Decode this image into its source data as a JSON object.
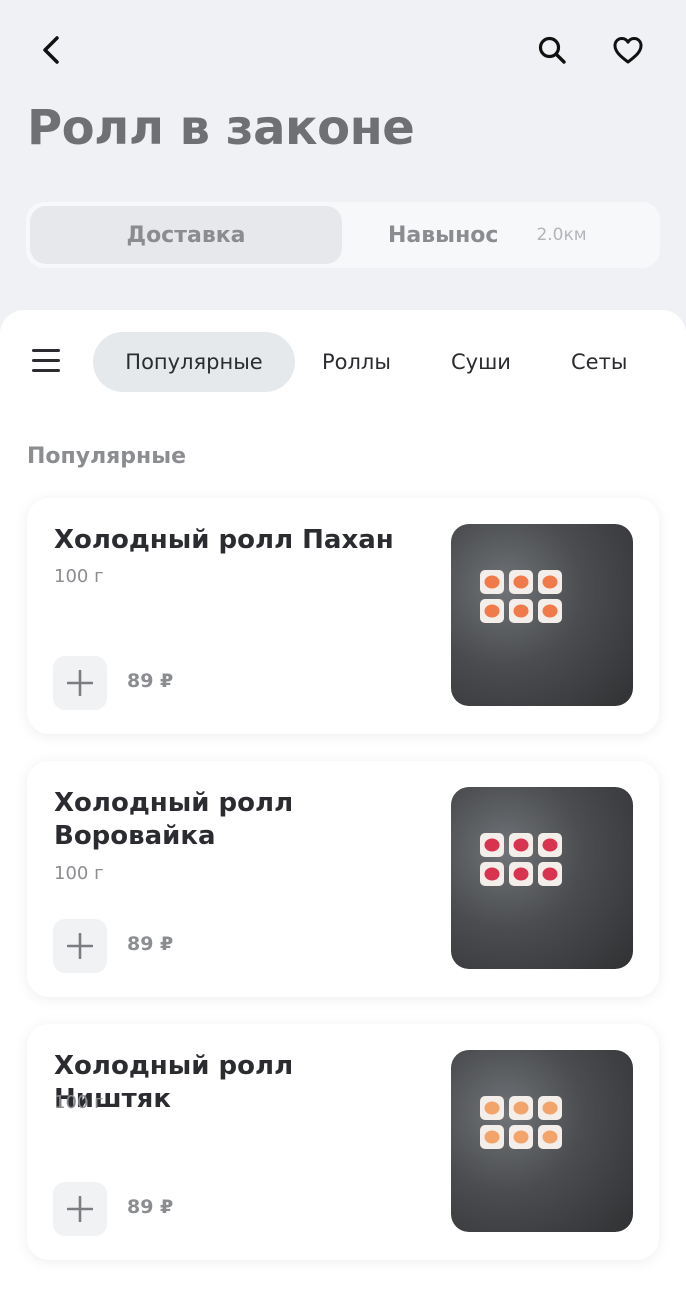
{
  "header": {
    "title": "Ролл в законе",
    "back_icon": "chevron-left-icon",
    "search_icon": "search-icon",
    "favorite_icon": "heart-icon"
  },
  "mode_switch": {
    "delivery_label": "Доставка",
    "pickup_label": "Навынос",
    "pickup_distance": "2.0км",
    "selected": "Доставка"
  },
  "categories": {
    "menu_icon": "hamburger-menu-icon",
    "items": [
      "Популярные",
      "Роллы",
      "Суши",
      "Сеты"
    ],
    "active": "Популярные"
  },
  "section": {
    "title": "Популярные"
  },
  "products": [
    {
      "name": "Холодный ролл Пахан",
      "weight": "100 г",
      "price": "89 ₽",
      "fish_color": "#f07a4a"
    },
    {
      "name": "Холодный ролл Воровайка",
      "weight": "100 г",
      "price": "89 ₽",
      "fish_color": "#d8344f"
    },
    {
      "name": "Холодный ролл Ништяк",
      "weight": "100 г",
      "price": "89 ₽",
      "fish_color": "#f2a46a"
    }
  ],
  "colors": {
    "background": "#f0f1f4",
    "active_pill": "#e6e9ec",
    "muted_text": "#8b8d91"
  }
}
